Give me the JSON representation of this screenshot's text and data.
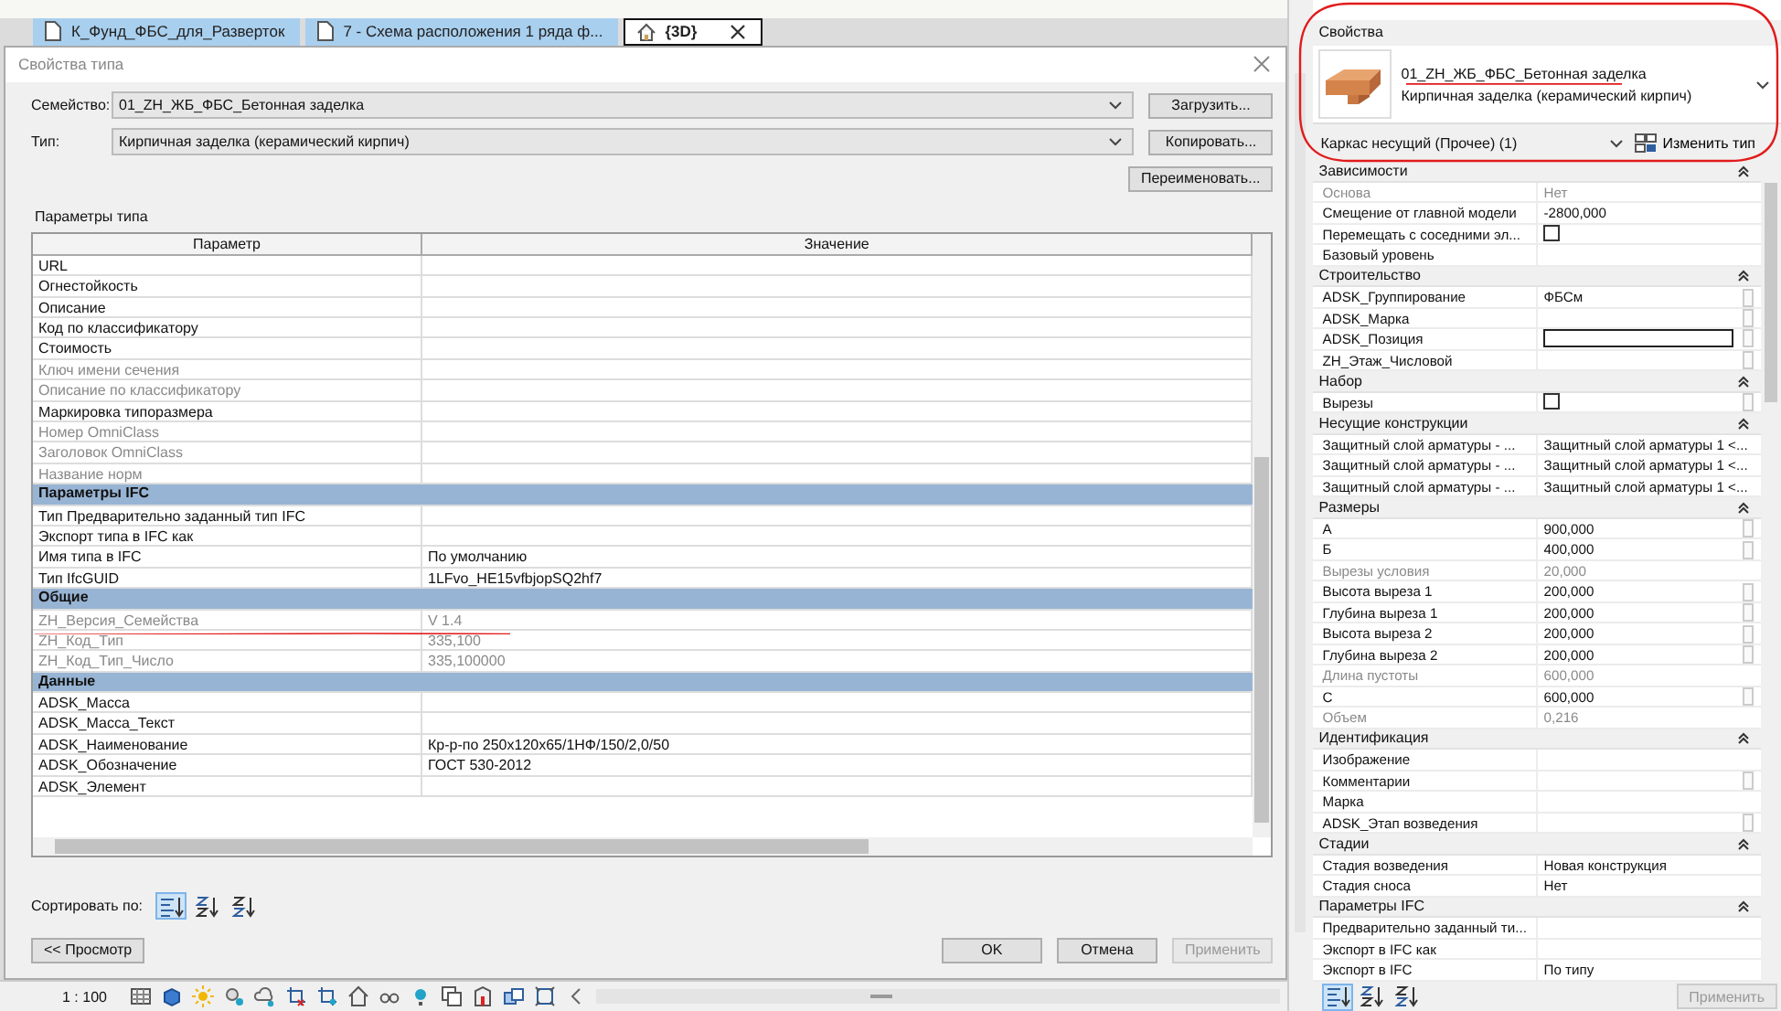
{
  "view_tabs": [
    {
      "label": "К_Фунд_ФБС_для_Разверток",
      "kind": "sheet",
      "selected": false
    },
    {
      "label": "7 - Схема расположения 1 ряда ф...",
      "kind": "sheet",
      "selected": false
    },
    {
      "label": "{3D}",
      "kind": "model",
      "selected": true
    }
  ],
  "dialog": {
    "title": "Свойства типа",
    "family": {
      "label": "Семейство:",
      "value": "01_ZH_ЖБ_ФБС_Бетонная заделка",
      "button": "Загрузить..."
    },
    "type": {
      "label": "Тип:",
      "value": "Кирпичная заделка (керамический кирпич)",
      "button": "Копировать..."
    },
    "rename_button": "Переименовать...",
    "section_label": "Параметры типа",
    "columns": [
      "Параметр",
      "Значение"
    ],
    "rows": [
      {
        "kind": "param",
        "name": "URL",
        "disabled": false
      },
      {
        "kind": "param",
        "name": "Огнестойкость",
        "disabled": false
      },
      {
        "kind": "param",
        "name": "Описание",
        "disabled": false
      },
      {
        "kind": "param",
        "name": "Код по классификатору",
        "disabled": false
      },
      {
        "kind": "param",
        "name": "Стоимость",
        "disabled": false
      },
      {
        "kind": "param",
        "name": "Ключ имени сечения",
        "disabled": true
      },
      {
        "kind": "param",
        "name": "Описание по классификатору",
        "disabled": true
      },
      {
        "kind": "param",
        "name": "Маркировка типоразмера",
        "disabled": false
      },
      {
        "kind": "param",
        "name": "Номер OmniClass",
        "disabled": true
      },
      {
        "kind": "param",
        "name": "Заголовок OmniClass",
        "disabled": true
      },
      {
        "kind": "param",
        "name": "Название норм",
        "disabled": true
      },
      {
        "kind": "group",
        "name": "Параметры IFC"
      },
      {
        "kind": "param",
        "name": "Тип Предварительно заданный тип IFC",
        "disabled": false
      },
      {
        "kind": "param",
        "name": "Экспорт типа в IFC как",
        "disabled": false
      },
      {
        "kind": "param",
        "name": "Имя типа в IFC",
        "value": "По умолчанию",
        "disabled": false
      },
      {
        "kind": "param",
        "name": "Тип IfcGUID",
        "value": "1LFvo_HE15vfbjopSQ2hf7",
        "disabled": false
      },
      {
        "kind": "group",
        "name": "Общие"
      },
      {
        "kind": "param",
        "name": "ZH_Версия_Семейства",
        "value": "V 1.4",
        "disabled": true
      },
      {
        "kind": "param",
        "name": "ZH_Код_Тип",
        "value": "335,100",
        "disabled": true
      },
      {
        "kind": "param",
        "name": "ZH_Код_Тип_Число",
        "value": "335,100000",
        "disabled": true
      },
      {
        "kind": "group",
        "name": "Данные"
      },
      {
        "kind": "param",
        "name": "ADSK_Масса",
        "disabled": false
      },
      {
        "kind": "param",
        "name": "ADSK_Масса_Текст",
        "disabled": false
      },
      {
        "kind": "param",
        "name": "ADSK_Наименование",
        "value": "Кр-р-по 250х120х65/1НФ/150/2,0/50",
        "disabled": false
      },
      {
        "kind": "param",
        "name": "ADSK_Обозначение",
        "value": "ГОСТ 530-2012",
        "disabled": false
      },
      {
        "kind": "param",
        "name": "ADSK_Элемент",
        "disabled": false
      }
    ],
    "sort_label": "Сортировать по:",
    "sort_modes": [
      {
        "kind": "grouped",
        "selected": true
      },
      {
        "kind": "ascending",
        "selected": false
      },
      {
        "kind": "descending",
        "selected": false
      }
    ],
    "preview_button": "<< Просмотр",
    "actions": [
      {
        "label": "OK",
        "disabled": false
      },
      {
        "label": "Отмена",
        "disabled": false
      },
      {
        "label": "Применить",
        "disabled": true
      }
    ]
  },
  "view_bar": {
    "scale": "1 : 100"
  },
  "properties": {
    "title": "Свойства",
    "family": "01_ZH_ЖБ_ФБС_Бетонная заделка",
    "type": "Кирпичная заделка (керамический кирпич)",
    "category": "Каркас несущий (Прочее) (1)",
    "edit_type": "Изменить тип",
    "groups": [
      {
        "name": "Зависимости",
        "rows": [
          {
            "kind": "text",
            "name": "Основа",
            "value": "Нет",
            "disabled": true,
            "linkable": false
          },
          {
            "kind": "text",
            "name": "Смещение от главной модели",
            "value": "-2800,000",
            "disabled": false,
            "linkable": false
          },
          {
            "kind": "checkbox",
            "name": "Перемещать с соседними эл...",
            "checked": false,
            "disabled": false,
            "linkable": false
          },
          {
            "kind": "text",
            "name": "Базовый уровень",
            "disabled": false,
            "linkable": false
          }
        ]
      },
      {
        "name": "Строительство",
        "rows": [
          {
            "kind": "text",
            "name": "ADSK_Группирование",
            "value": "ФБСм",
            "disabled": false,
            "linkable": true
          },
          {
            "kind": "text",
            "name": "ADSK_Марка",
            "disabled": false,
            "linkable": true
          },
          {
            "kind": "field",
            "name": "ADSK_Позиция",
            "disabled": false,
            "linkable": true
          },
          {
            "kind": "text",
            "name": "ZH_Этаж_Числовой",
            "disabled": false,
            "linkable": true
          }
        ]
      },
      {
        "name": "Набор",
        "rows": [
          {
            "kind": "checkbox",
            "name": "Вырезы",
            "checked": false,
            "disabled": false,
            "linkable": true
          }
        ]
      },
      {
        "name": "Несущие конструкции",
        "rows": [
          {
            "kind": "text",
            "name": "Защитный слой арматуры - ...",
            "value": "Защитный слой арматуры 1 <...",
            "disabled": false,
            "linkable": false
          },
          {
            "kind": "text",
            "name": "Защитный слой арматуры - ...",
            "value": "Защитный слой арматуры 1 <...",
            "disabled": false,
            "linkable": false
          },
          {
            "kind": "text",
            "name": "Защитный слой арматуры - ...",
            "value": "Защитный слой арматуры 1 <...",
            "disabled": false,
            "linkable": false
          }
        ]
      },
      {
        "name": "Размеры",
        "rows": [
          {
            "kind": "text",
            "name": "А",
            "value": "900,000",
            "disabled": false,
            "linkable": true
          },
          {
            "kind": "text",
            "name": "Б",
            "value": "400,000",
            "disabled": false,
            "linkable": true
          },
          {
            "kind": "text",
            "name": "Вырезы условия",
            "value": "20,000",
            "disabled": true,
            "linkable": false
          },
          {
            "kind": "text",
            "name": "Высота выреза 1",
            "value": "200,000",
            "disabled": false,
            "linkable": true
          },
          {
            "kind": "text",
            "name": "Глубина выреза 1",
            "value": "200,000",
            "disabled": false,
            "linkable": true
          },
          {
            "kind": "text",
            "name": "Высота выреза 2",
            "value": "200,000",
            "disabled": false,
            "linkable": true
          },
          {
            "kind": "text",
            "name": "Глубина выреза 2",
            "value": "200,000",
            "disabled": false,
            "linkable": true
          },
          {
            "kind": "text",
            "name": "Длина пустоты",
            "value": "600,000",
            "disabled": true,
            "linkable": false
          },
          {
            "kind": "text",
            "name": "С",
            "value": "600,000",
            "disabled": false,
            "linkable": true
          },
          {
            "kind": "text",
            "name": "Объем",
            "value": "0,216",
            "disabled": true,
            "linkable": false
          }
        ]
      },
      {
        "name": "Идентификация",
        "rows": [
          {
            "kind": "text",
            "name": "Изображение",
            "disabled": false,
            "linkable": false
          },
          {
            "kind": "text",
            "name": "Комментарии",
            "disabled": false,
            "linkable": true
          },
          {
            "kind": "text",
            "name": "Марка",
            "disabled": false,
            "linkable": false
          },
          {
            "kind": "text",
            "name": "ADSK_Этап возведения",
            "disabled": false,
            "linkable": true
          }
        ]
      },
      {
        "name": "Стадии",
        "rows": [
          {
            "kind": "text",
            "name": "Стадия возведения",
            "value": "Новая конструкция",
            "disabled": false,
            "linkable": false
          },
          {
            "kind": "text",
            "name": "Стадия сноса",
            "value": "Нет",
            "disabled": false,
            "linkable": false
          }
        ]
      },
      {
        "name": "Параметры IFC",
        "rows": [
          {
            "kind": "text",
            "name": "Предварительно заданный ти...",
            "disabled": false,
            "linkable": false
          },
          {
            "kind": "text",
            "name": "Экспорт в IFC как",
            "disabled": false,
            "linkable": false
          },
          {
            "kind": "text",
            "name": "Экспорт в IFC",
            "value": "По типу",
            "disabled": false,
            "linkable": false
          }
        ]
      }
    ],
    "sort_modes": [
      {
        "kind": "grouped",
        "selected": true
      },
      {
        "kind": "ascending",
        "selected": false
      },
      {
        "kind": "descending",
        "selected": false
      }
    ],
    "apply": {
      "label": "Применить",
      "disabled": true
    }
  }
}
